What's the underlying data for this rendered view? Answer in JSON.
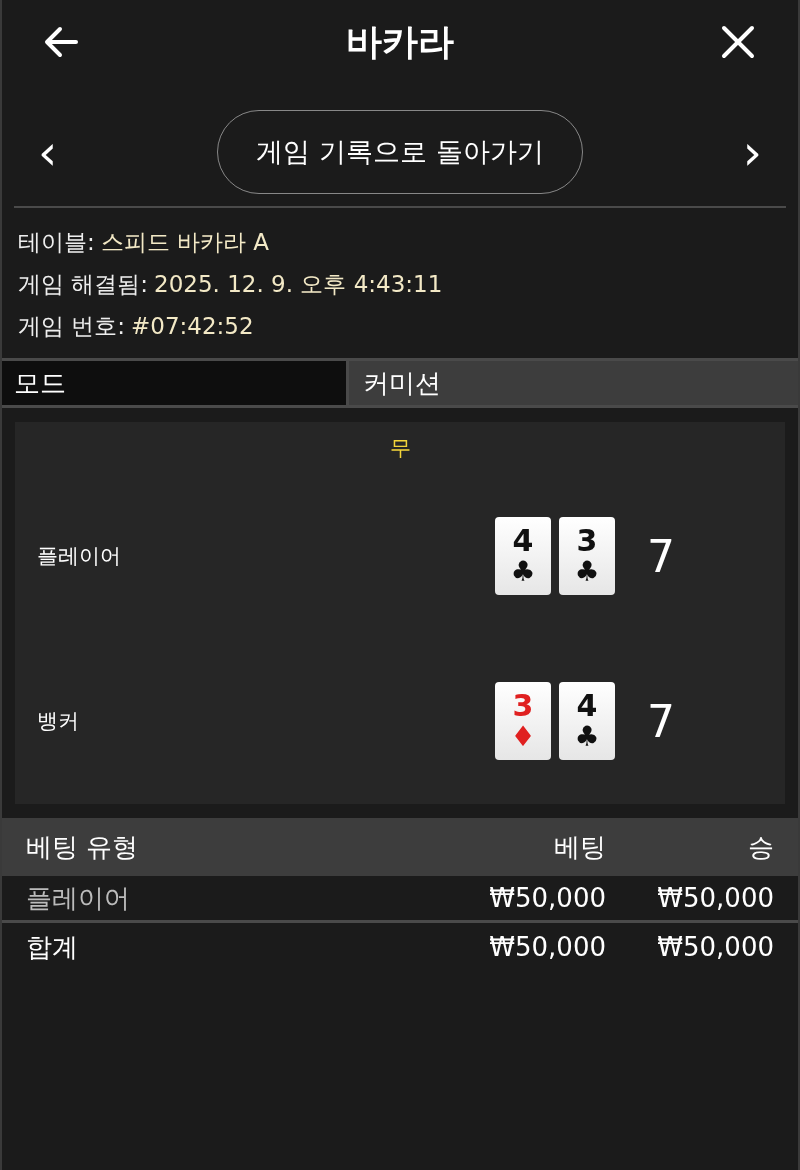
{
  "header": {
    "title": "바카라"
  },
  "nav": {
    "prev": "‹",
    "button": "게임 기록으로 돌아가기",
    "next": "›"
  },
  "info": [
    {
      "label": "테이블:",
      "value": "스피드 바카라 A"
    },
    {
      "label": "게임 해결됨:",
      "value": "2025. 12. 9. 오후 4:43:11"
    },
    {
      "label": "게임 번호:",
      "value": "#07:42:52"
    }
  ],
  "mode": {
    "label": "모드",
    "value": "커미션"
  },
  "result": {
    "outcome": "무",
    "hands": [
      {
        "name": "플레이어",
        "total": "7",
        "cards": [
          {
            "rank": "4",
            "suit": "♣",
            "color": "#111111"
          },
          {
            "rank": "3",
            "suit": "♣",
            "color": "#111111"
          }
        ]
      },
      {
        "name": "뱅커",
        "total": "7",
        "cards": [
          {
            "rank": "3",
            "suit": "♦",
            "color": "#e02020"
          },
          {
            "rank": "4",
            "suit": "♣",
            "color": "#111111"
          }
        ]
      }
    ]
  },
  "bets": {
    "columns": [
      "베팅 유형",
      "베팅",
      "승"
    ],
    "rows": [
      {
        "kind": "bet",
        "cells": [
          "플레이어",
          "₩50,000",
          "₩50,000"
        ]
      },
      {
        "kind": "total",
        "cells": [
          "합계",
          "₩50,000",
          "₩50,000"
        ]
      }
    ]
  }
}
